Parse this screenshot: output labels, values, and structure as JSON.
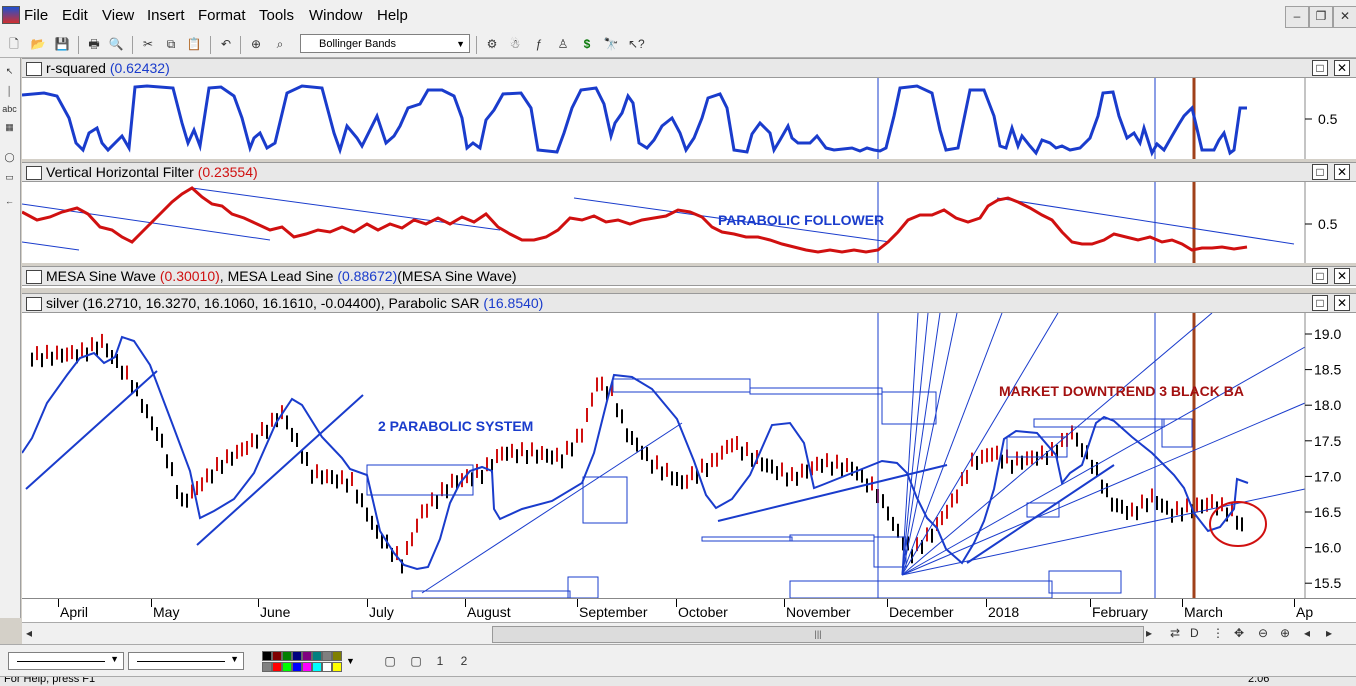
{
  "menu": [
    "File",
    "Edit",
    "View",
    "Insert",
    "Format",
    "Tools",
    "Window",
    "Help"
  ],
  "toolbar": {
    "study_select": "Bollinger Bands"
  },
  "panes": {
    "rsq": {
      "label": "r-squared",
      "value": "(0.62432)",
      "axis": [
        "0.5"
      ]
    },
    "vhf": {
      "label": "Vertical Horizontal Filter",
      "value": "(0.23554)",
      "axis": [
        "0.5"
      ],
      "annotation": "PARABOLIC FOLLOWER"
    },
    "mesa": {
      "label1": "MESA Sine Wave ",
      "value1": "(0.30010)",
      "label2": ", MESA Lead Sine ",
      "value2": "(0.88672)",
      "label3": "(MESA Sine Wave)"
    },
    "price": {
      "label1": "silver (16.2710, 16.3270, 16.1060, 16.1610, -0.04400), Parabolic SAR ",
      "value1": "(16.8540)",
      "axis": [
        "19.0",
        "18.5",
        "18.0",
        "17.5",
        "17.0",
        "16.5",
        "16.0",
        "15.5"
      ],
      "annotation1": "2 PARABOLIC SYSTEM",
      "annotation2": "MARKET  DOWNTREND 3 BLACK BA"
    }
  },
  "date_axis": [
    "April",
    "May",
    "June",
    "July",
    "August",
    "September",
    "October",
    "November",
    "December",
    "2018",
    "February",
    "March",
    "Ap"
  ],
  "colors": {
    "blue": "#1a3ccc",
    "red": "#d01010",
    "darkred": "#a31010",
    "brown": "#a0401a"
  },
  "status": {
    "left": "For Help, press F1",
    "right": "2:06"
  }
}
